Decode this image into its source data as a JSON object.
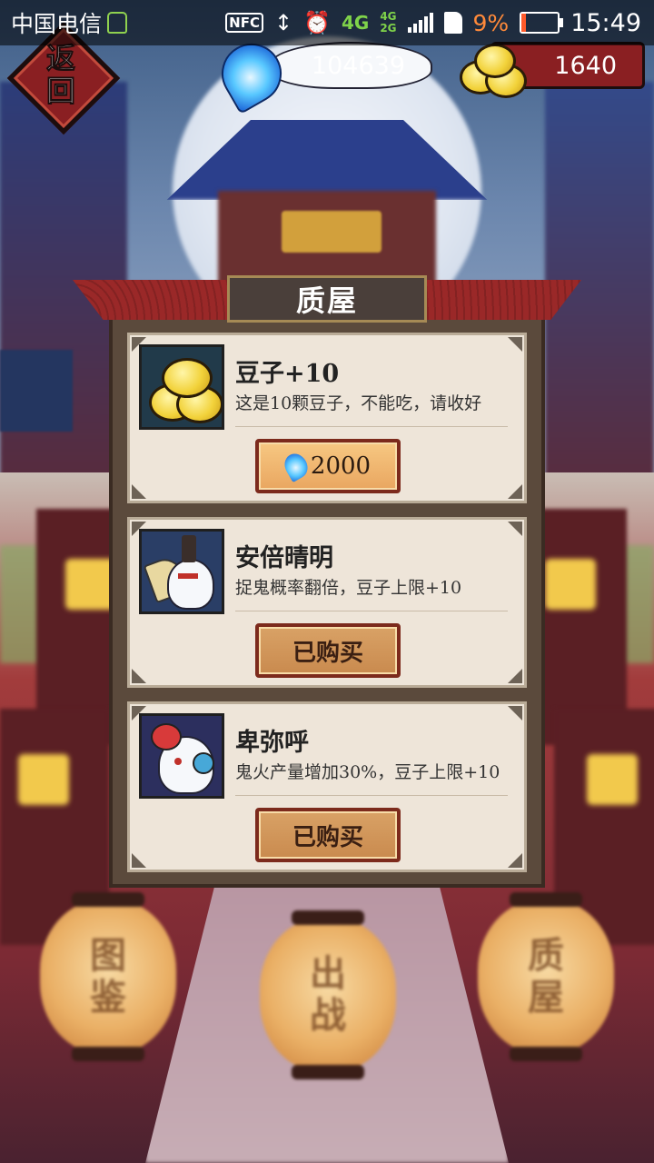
{
  "status_bar": {
    "carrier": "中国电信",
    "nfc": "NFC",
    "network": "4G",
    "network_secondary": [
      "4G",
      "2G"
    ],
    "battery_percent": "9%",
    "battery_level": 0.09,
    "time": "15:49"
  },
  "hud": {
    "back_label": [
      "返",
      "回"
    ],
    "ghost_fire": "104639",
    "beans": "1640"
  },
  "panel": {
    "title": "质屋",
    "items": [
      {
        "name": "豆子+10",
        "desc": "这是10颗豆子，不能吃，请收好",
        "button": "2000",
        "bought": false,
        "icon": "beans-icon"
      },
      {
        "name": "安倍晴明",
        "desc": "捉鬼概率翻倍，豆子上限+10",
        "button": "已购买",
        "bought": true,
        "icon": "seimei-ghost-icon"
      },
      {
        "name": "卑弥呼",
        "desc": "鬼火产量增加30%，豆子上限+10",
        "button": "已购买",
        "bought": true,
        "icon": "himiko-ghost-icon"
      }
    ]
  },
  "lanterns": [
    "图鉴",
    "出战",
    "质屋"
  ],
  "colors": {
    "panel_red": "#9a2828",
    "card_bg": "#eee5d9",
    "button_orange": "#e9a660",
    "battery_low": "#ff5a2a",
    "network_green": "#7fd34a"
  }
}
